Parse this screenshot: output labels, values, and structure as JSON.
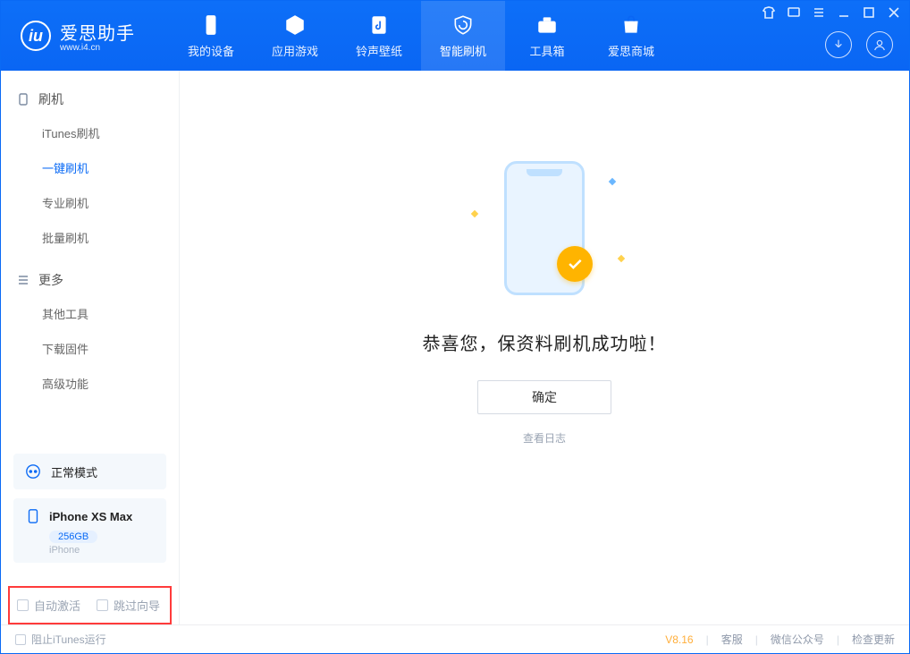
{
  "app": {
    "title": "爱思助手",
    "url": "www.i4.cn"
  },
  "nav": {
    "items": [
      {
        "label": "我的设备"
      },
      {
        "label": "应用游戏"
      },
      {
        "label": "铃声壁纸"
      },
      {
        "label": "智能刷机"
      },
      {
        "label": "工具箱"
      },
      {
        "label": "爱思商城"
      }
    ],
    "active_index": 3
  },
  "sidebar": {
    "groups": [
      {
        "title": "刷机",
        "items": [
          {
            "label": "iTunes刷机"
          },
          {
            "label": "一键刷机"
          },
          {
            "label": "专业刷机"
          },
          {
            "label": "批量刷机"
          }
        ],
        "active_index": 1
      },
      {
        "title": "更多",
        "items": [
          {
            "label": "其他工具"
          },
          {
            "label": "下载固件"
          },
          {
            "label": "高级功能"
          }
        ],
        "active_index": -1
      }
    ],
    "mode_label": "正常模式",
    "device": {
      "name": "iPhone XS Max",
      "storage": "256GB",
      "type": "iPhone"
    },
    "checkboxes": {
      "auto_activate": "自动激活",
      "skip_guide": "跳过向导"
    }
  },
  "main": {
    "success_text": "恭喜您，保资料刷机成功啦！",
    "ok_button": "确定",
    "view_log": "查看日志"
  },
  "footer": {
    "block_itunes": "阻止iTunes运行",
    "version": "V8.16",
    "links": {
      "service": "客服",
      "wechat": "微信公众号",
      "update": "检查更新"
    }
  }
}
